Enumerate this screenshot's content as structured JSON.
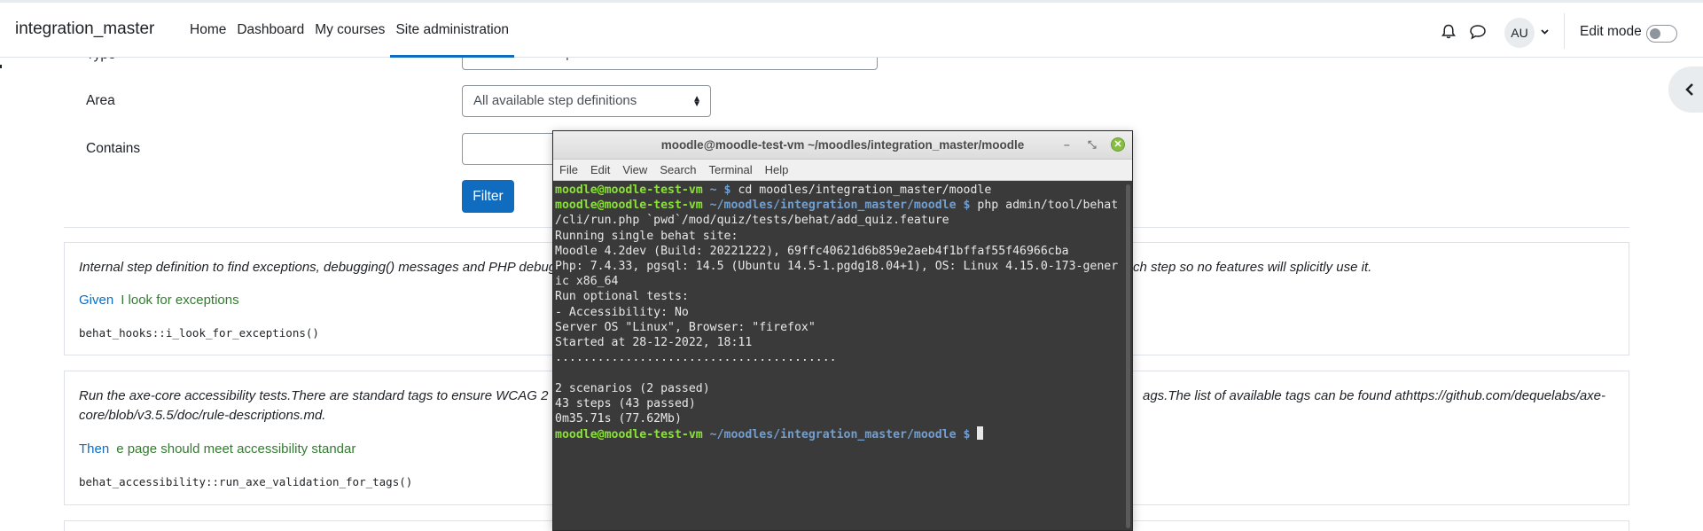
{
  "navbar": {
    "brand": "integration_master",
    "links": [
      "Home",
      "Dashboard",
      "My courses",
      "Site administration"
    ],
    "active_link": "Site administration",
    "avatar_initials": "AU",
    "edit_mode_label": "Edit mode"
  },
  "form": {
    "type_label": "Type",
    "type_value": "All available step definitions",
    "area_label": "Area",
    "area_value": "All available step definitions",
    "contains_label": "Contains",
    "contains_value": "",
    "filter_button": "Filter"
  },
  "steps": [
    {
      "description": "Internal step definition to find exceptions, debugging() messages and PHP debug",
      "description_tail": "ch step so no features will splicitly use it.",
      "keyword": "Given",
      "phrase": "I look for exceptions",
      "method": "behat_hooks::i_look_for_exceptions()"
    },
    {
      "description": "Run the axe-core accessibility tests.There are standard tags to ensure WCAG 2",
      "description_tail": "ags.The list of available tags can be found athttps://github.com/dequelabs/axe-",
      "description_line2": "core/blob/v3.5.5/doc/rule-descriptions.md.",
      "keyword": "Then",
      "phrase": "e page should meet accessibility standar",
      "method": "behat_accessibility::run_axe_validation_for_tags()"
    }
  ],
  "terminal": {
    "title": "moodle@moodle-test-vm ~/moodles/integration_master/moodle",
    "menu": [
      "File",
      "Edit",
      "View",
      "Search",
      "Terminal",
      "Help"
    ],
    "user": "moodle@moodle-test-vm",
    "line1_path": " ~ $ ",
    "line1_cmd": "cd moodles/integration_master/moodle",
    "line2_path": " ~/moodles/integration_master/moodle $ ",
    "line2_cmd": "php admin/tool/behat",
    "line3": "/cli/run.php `pwd`/mod/quiz/tests/behat/add_quiz.feature",
    "output": [
      "Running single behat site:",
      "Moodle 4.2dev (Build: 20221222), 69ffc40621d6b859e2aeb4f1bffaf55f46966cba",
      "Php: 7.4.33, pgsql: 14.5 (Ubuntu 14.5-1.pgdg18.04+1), OS: Linux 4.15.0-173-gener",
      "ic x86_64",
      "Run optional tests:",
      "- Accessibility: No",
      "Server OS \"Linux\", Browser: \"firefox\"",
      "Started at 28-12-2022, 18:11",
      "........................................",
      "",
      "2 scenarios (2 passed)",
      "43 steps (43 passed)",
      "0m35.71s (77.62Mb)"
    ],
    "final_path": " ~/moodles/integration_master/moodle $ "
  },
  "icons": [
    "bell-icon",
    "chat-icon",
    "chevron-down-icon",
    "toggle-switch",
    "chevron-left-icon",
    "close-icon",
    "minimize-icon",
    "maximize-icon"
  ],
  "colors": {
    "primary": "#0f6cbf",
    "step_phrase": "#357a32",
    "terminal_bg": "#3a3a3a",
    "prompt_user": "#8ae234",
    "prompt_path": "#729fcf"
  }
}
